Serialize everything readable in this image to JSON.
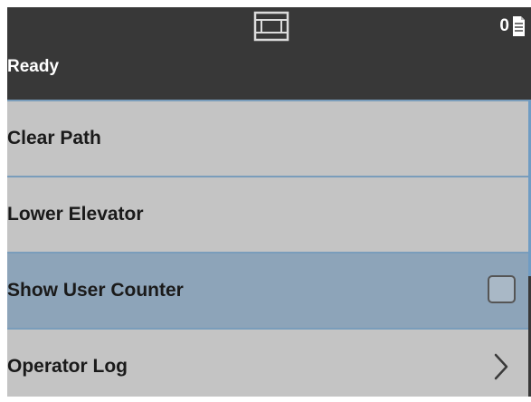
{
  "status": {
    "text": "Ready",
    "counter": "0",
    "center_icon": "scanner-icon",
    "counter_icon": "document-icon"
  },
  "menu": {
    "items": [
      {
        "label": "Clear Path"
      },
      {
        "label": "Lower Elevator"
      },
      {
        "label": "Show User Counter",
        "control": "checkbox",
        "checked": false,
        "selected": true
      },
      {
        "label": "Operator Log",
        "control": "chevron"
      }
    ]
  },
  "colors": {
    "status_bar": "#383838",
    "item_bg": "#c4c4c4",
    "item_selected_bg": "#8da4b9",
    "divider": "#7a9dbb",
    "scroll_thumb": "#6f9cc4"
  }
}
